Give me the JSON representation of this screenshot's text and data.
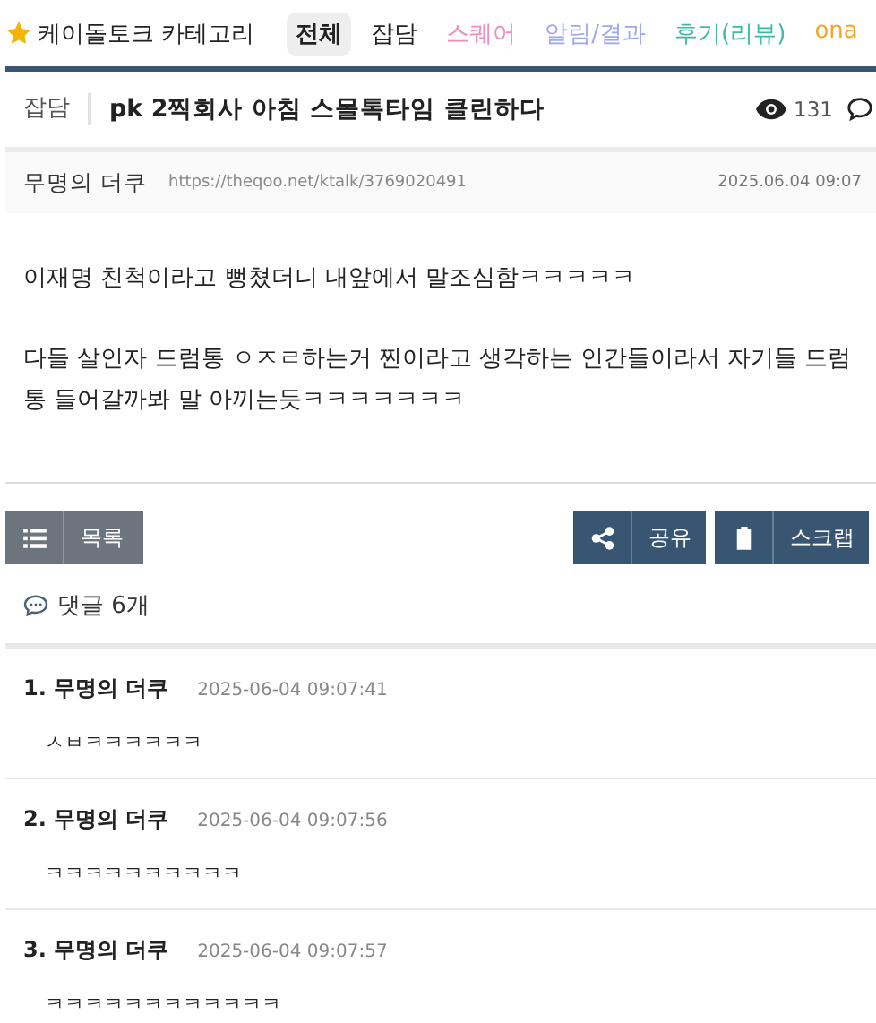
{
  "category": {
    "title": "케이돌토크 카테고리"
  },
  "tabs": [
    {
      "label": "전체",
      "selected": true,
      "color": "#222222"
    },
    {
      "label": "잡담",
      "selected": false,
      "color": "#222222"
    },
    {
      "label": "스퀘어",
      "selected": false,
      "color": "#f28cbf"
    },
    {
      "label": "알림/결과",
      "selected": false,
      "color": "#9fa8f2"
    },
    {
      "label": "후기(리뷰)",
      "selected": false,
      "color": "#3dbaa6"
    },
    {
      "label": "ona",
      "selected": false,
      "color": "#f5a52a"
    }
  ],
  "post": {
    "category": "잡담",
    "title": "pk 2찍회사 아침 스몰톡타임 클린하다",
    "views": "131",
    "author": "무명의 더쿠",
    "url": "https://theqoo.net/ktalk/3769020491",
    "date": "2025.06.04 09:07",
    "paragraphs": [
      "이재명 친척이라고 뻥쳤더니 내앞에서 말조심함ㅋㅋㅋㅋㅋ",
      "다들 살인자 드럼통 ㅇㅈㄹ하는거 찐이라고 생각하는 인간들이라서 자기들 드럼통 들어갈까봐 말 아끼는듯ㅋㅋㅋㅋㅋㅋㅋ"
    ]
  },
  "buttons": {
    "list": "목록",
    "share": "공유",
    "scrap": "스크랩"
  },
  "comments": {
    "header": "댓글 6개",
    "items": [
      {
        "index": "1.",
        "author": "무명의 더쿠",
        "time": "2025-06-04 09:07:41",
        "text": "ㅅㅂㅋㅋㅋㅋㅋㅋ"
      },
      {
        "index": "2.",
        "author": "무명의 더쿠",
        "time": "2025-06-04 09:07:56",
        "text": "ㅋㅋㅋㅋㅋㅋㅋㅋㅋㅋ"
      },
      {
        "index": "3.",
        "author": "무명의 더쿠",
        "time": "2025-06-04 09:07:57",
        "text": "ㅋㅋㅋㅋㅋㅋㅋㅋㅋㅋㅋㅋ"
      }
    ]
  }
}
